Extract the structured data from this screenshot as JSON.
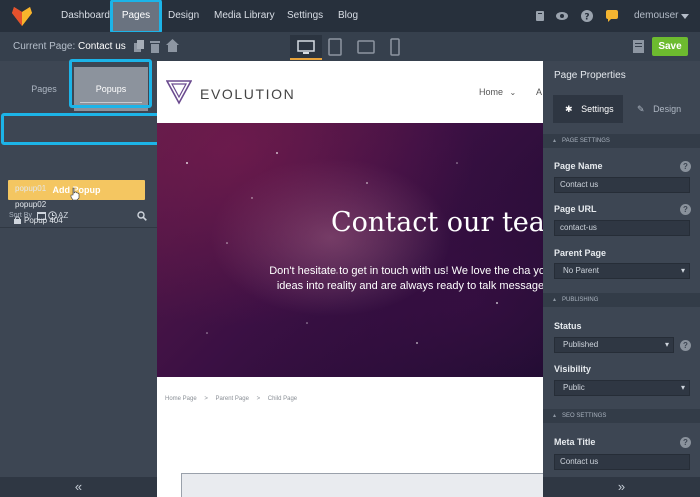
{
  "topnav": {
    "items": [
      {
        "label": "Dashboard"
      },
      {
        "label": "Pages"
      },
      {
        "label": "Design"
      },
      {
        "label": "Media Library"
      },
      {
        "label": "Settings"
      },
      {
        "label": "Blog"
      }
    ],
    "active_item": "Pages",
    "user": "demouser"
  },
  "toolbar": {
    "current_page_label": "Current Page:",
    "current_page_value": "Contact us",
    "device_active": "desktop",
    "save_label": "Save"
  },
  "left_panel": {
    "tabs": [
      {
        "label": "Pages"
      },
      {
        "label": "Popups"
      }
    ],
    "active_tab": "Popups",
    "add_button": "Add Popup",
    "sort_label": "Sort By",
    "sort_az": "AZ",
    "popups": [
      {
        "label": "popup01",
        "locked": false
      },
      {
        "label": "popup02",
        "locked": false
      },
      {
        "label": "Popup 404",
        "locked": true
      }
    ]
  },
  "site": {
    "brand": "EVOLUTION",
    "nav_home": "Home",
    "nav_next": "A",
    "hero_title": "Contact our tear",
    "hero_text": "Don't hesitate to get in touch with us! We love the cha your ideas into reality and are always ready to talk message.",
    "breadcrumb": [
      "Home Page",
      ">",
      "Parent Page",
      ">",
      "Child Page"
    ]
  },
  "right_panel": {
    "title": "Page Properties",
    "tabs": [
      {
        "label": "Settings"
      },
      {
        "label": "Design"
      }
    ],
    "active_tab": "Settings",
    "sections": {
      "page_settings": "PAGE SETTINGS",
      "publishing": "PUBLISHING",
      "seo_settings": "SEO SETTINGS"
    },
    "fields": {
      "page_name_label": "Page Name",
      "page_name_value": "Contact us",
      "page_url_label": "Page URL",
      "page_url_value": "contact-us",
      "parent_page_label": "Parent Page",
      "parent_page_value": "No Parent",
      "status_label": "Status",
      "status_value": "Published",
      "visibility_label": "Visibility",
      "visibility_value": "Public",
      "meta_title_label": "Meta Title",
      "meta_title_value": "Contact us"
    }
  },
  "colors": {
    "highlight": "#1cb4e8",
    "save": "#6dbb2f",
    "add_popup": "#f4c661",
    "accent_underline": "#e8a33b"
  }
}
